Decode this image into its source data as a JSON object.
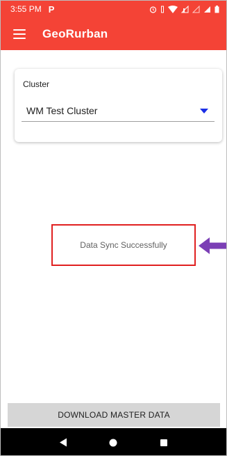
{
  "status_bar": {
    "time": "3:55 PM",
    "notification_glyph": "P",
    "icons": [
      "alarm-icon",
      "vibrate-icon",
      "wifi-icon",
      "data-icon",
      "signal-empty-icon",
      "signal-icon",
      "battery-icon"
    ]
  },
  "app_bar": {
    "title": "GeoRurban",
    "menu_icon": "hamburger-menu-icon"
  },
  "cluster": {
    "label": "Cluster",
    "selected": "WM Test Cluster",
    "dropdown_icon": "caret-down-icon"
  },
  "toast": {
    "message": "Data Sync Successfully"
  },
  "actions": {
    "download_label": "DOWNLOAD MASTER DATA"
  },
  "nav": {
    "back_icon": "back-triangle-icon",
    "home_icon": "home-circle-icon",
    "recents_icon": "recents-square-icon"
  },
  "colors": {
    "primary": "#f44336",
    "dropdown_accent": "#1a2ee6",
    "highlight_border": "#e02020",
    "annotation_arrow": "#7b3fb5",
    "button_bg": "#d6d6d6"
  }
}
